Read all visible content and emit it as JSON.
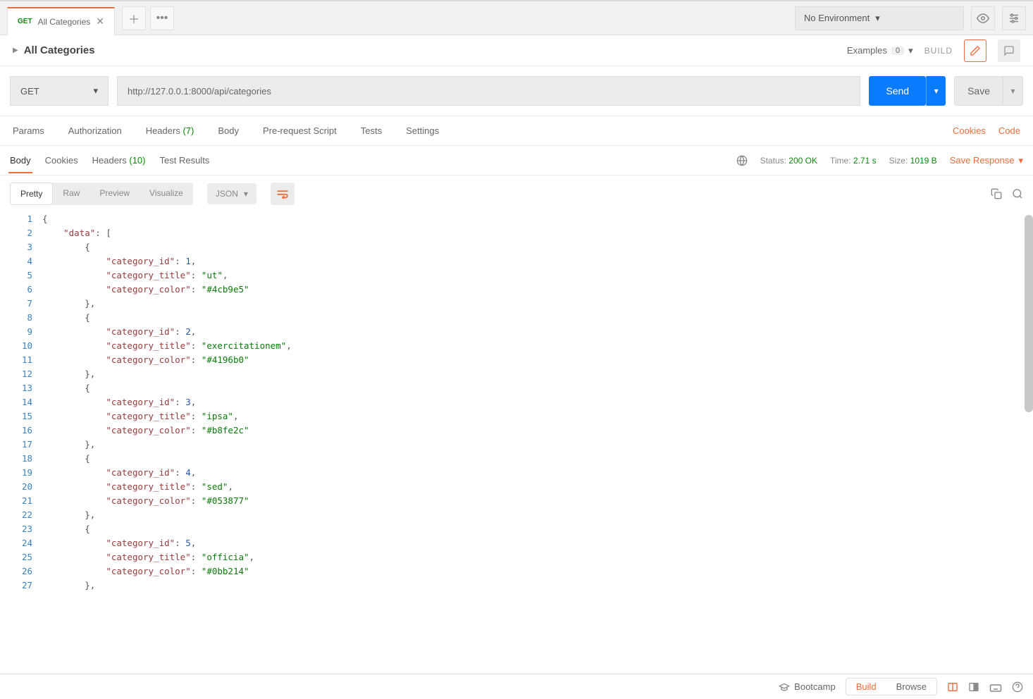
{
  "tab": {
    "method": "GET",
    "label": "All Categories"
  },
  "environment": {
    "label": "No Environment"
  },
  "request": {
    "title": "All Categories",
    "examples_label": "Examples",
    "examples_count": "0",
    "build_label": "BUILD",
    "method": "GET",
    "url": "http://127.0.0.1:8000/api/categories",
    "send_label": "Send",
    "save_label": "Save"
  },
  "req_tabs": {
    "params": "Params",
    "authorization": "Authorization",
    "headers": "Headers",
    "headers_count": "(7)",
    "body": "Body",
    "prerequest": "Pre-request Script",
    "tests": "Tests",
    "settings": "Settings",
    "cookies": "Cookies",
    "code": "Code"
  },
  "resp_tabs": {
    "body": "Body",
    "cookies": "Cookies",
    "headers": "Headers",
    "headers_count": "(10)",
    "test_results": "Test Results"
  },
  "status": {
    "status_label": "Status:",
    "status_value": "200 OK",
    "time_label": "Time:",
    "time_value": "2.71 s",
    "size_label": "Size:",
    "size_value": "1019 B",
    "save_response": "Save Response"
  },
  "pretty": {
    "pretty": "Pretty",
    "raw": "Raw",
    "preview": "Preview",
    "visualize": "Visualize",
    "json": "JSON"
  },
  "code_lines": [
    [
      {
        "t": "p",
        "v": "{"
      }
    ],
    [
      {
        "t": "p",
        "v": "    "
      },
      {
        "t": "k",
        "v": "\"data\""
      },
      {
        "t": "p",
        "v": ": ["
      }
    ],
    [
      {
        "t": "p",
        "v": "        {"
      }
    ],
    [
      {
        "t": "p",
        "v": "            "
      },
      {
        "t": "k",
        "v": "\"category_id\""
      },
      {
        "t": "p",
        "v": ": "
      },
      {
        "t": "n",
        "v": "1"
      },
      {
        "t": "p",
        "v": ","
      }
    ],
    [
      {
        "t": "p",
        "v": "            "
      },
      {
        "t": "k",
        "v": "\"category_title\""
      },
      {
        "t": "p",
        "v": ": "
      },
      {
        "t": "s",
        "v": "\"ut\""
      },
      {
        "t": "p",
        "v": ","
      }
    ],
    [
      {
        "t": "p",
        "v": "            "
      },
      {
        "t": "k",
        "v": "\"category_color\""
      },
      {
        "t": "p",
        "v": ": "
      },
      {
        "t": "s",
        "v": "\"#4cb9e5\""
      }
    ],
    [
      {
        "t": "p",
        "v": "        },"
      }
    ],
    [
      {
        "t": "p",
        "v": "        {"
      }
    ],
    [
      {
        "t": "p",
        "v": "            "
      },
      {
        "t": "k",
        "v": "\"category_id\""
      },
      {
        "t": "p",
        "v": ": "
      },
      {
        "t": "n",
        "v": "2"
      },
      {
        "t": "p",
        "v": ","
      }
    ],
    [
      {
        "t": "p",
        "v": "            "
      },
      {
        "t": "k",
        "v": "\"category_title\""
      },
      {
        "t": "p",
        "v": ": "
      },
      {
        "t": "s",
        "v": "\"exercitationem\""
      },
      {
        "t": "p",
        "v": ","
      }
    ],
    [
      {
        "t": "p",
        "v": "            "
      },
      {
        "t": "k",
        "v": "\"category_color\""
      },
      {
        "t": "p",
        "v": ": "
      },
      {
        "t": "s",
        "v": "\"#4196b0\""
      }
    ],
    [
      {
        "t": "p",
        "v": "        },"
      }
    ],
    [
      {
        "t": "p",
        "v": "        {"
      }
    ],
    [
      {
        "t": "p",
        "v": "            "
      },
      {
        "t": "k",
        "v": "\"category_id\""
      },
      {
        "t": "p",
        "v": ": "
      },
      {
        "t": "n",
        "v": "3"
      },
      {
        "t": "p",
        "v": ","
      }
    ],
    [
      {
        "t": "p",
        "v": "            "
      },
      {
        "t": "k",
        "v": "\"category_title\""
      },
      {
        "t": "p",
        "v": ": "
      },
      {
        "t": "s",
        "v": "\"ipsa\""
      },
      {
        "t": "p",
        "v": ","
      }
    ],
    [
      {
        "t": "p",
        "v": "            "
      },
      {
        "t": "k",
        "v": "\"category_color\""
      },
      {
        "t": "p",
        "v": ": "
      },
      {
        "t": "s",
        "v": "\"#b8fe2c\""
      }
    ],
    [
      {
        "t": "p",
        "v": "        },"
      }
    ],
    [
      {
        "t": "p",
        "v": "        {"
      }
    ],
    [
      {
        "t": "p",
        "v": "            "
      },
      {
        "t": "k",
        "v": "\"category_id\""
      },
      {
        "t": "p",
        "v": ": "
      },
      {
        "t": "n",
        "v": "4"
      },
      {
        "t": "p",
        "v": ","
      }
    ],
    [
      {
        "t": "p",
        "v": "            "
      },
      {
        "t": "k",
        "v": "\"category_title\""
      },
      {
        "t": "p",
        "v": ": "
      },
      {
        "t": "s",
        "v": "\"sed\""
      },
      {
        "t": "p",
        "v": ","
      }
    ],
    [
      {
        "t": "p",
        "v": "            "
      },
      {
        "t": "k",
        "v": "\"category_color\""
      },
      {
        "t": "p",
        "v": ": "
      },
      {
        "t": "s",
        "v": "\"#053877\""
      }
    ],
    [
      {
        "t": "p",
        "v": "        },"
      }
    ],
    [
      {
        "t": "p",
        "v": "        {"
      }
    ],
    [
      {
        "t": "p",
        "v": "            "
      },
      {
        "t": "k",
        "v": "\"category_id\""
      },
      {
        "t": "p",
        "v": ": "
      },
      {
        "t": "n",
        "v": "5"
      },
      {
        "t": "p",
        "v": ","
      }
    ],
    [
      {
        "t": "p",
        "v": "            "
      },
      {
        "t": "k",
        "v": "\"category_title\""
      },
      {
        "t": "p",
        "v": ": "
      },
      {
        "t": "s",
        "v": "\"officia\""
      },
      {
        "t": "p",
        "v": ","
      }
    ],
    [
      {
        "t": "p",
        "v": "            "
      },
      {
        "t": "k",
        "v": "\"category_color\""
      },
      {
        "t": "p",
        "v": ": "
      },
      {
        "t": "s",
        "v": "\"#0bb214\""
      }
    ],
    [
      {
        "t": "p",
        "v": "        },"
      }
    ]
  ],
  "footer": {
    "bootcamp": "Bootcamp",
    "build": "Build",
    "browse": "Browse"
  }
}
